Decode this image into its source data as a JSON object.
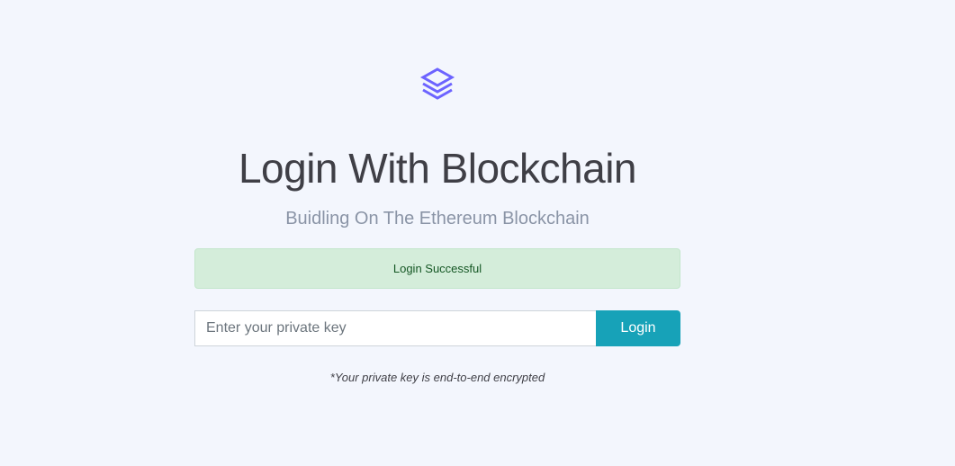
{
  "logo": {
    "icon": "layers-icon",
    "color": "#6c63ff"
  },
  "title": "Login With Blockchain",
  "subtitle": "Buidling On The Ethereum Blockchain",
  "alert": {
    "text": "Login Successful"
  },
  "form": {
    "placeholder": "Enter your private key",
    "value": "",
    "button": "Login"
  },
  "note": "*Your private key is end-to-end encrypted"
}
